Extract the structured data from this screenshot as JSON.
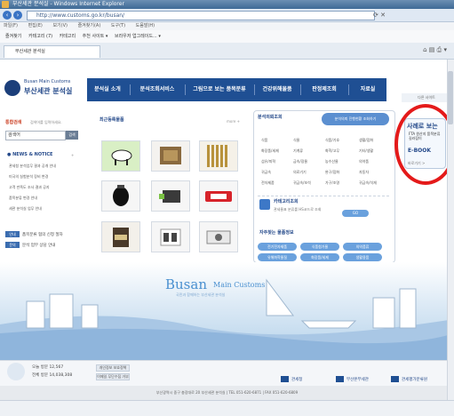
{
  "browser": {
    "window_title": "부산세관 분석실 - Windows Internet Explorer",
    "url": "http://www.customs.go.kr/busan/",
    "menu": [
      "파일(F)",
      "편집(E)",
      "보기(V)",
      "즐겨찾기(A)",
      "도구(T)",
      "도움말(H)"
    ],
    "favorites_bar": [
      "즐겨찾기",
      "카테고리 (7)",
      "카테고리",
      "추천 사이트 ▾",
      "브라우저 업그레이드... ▾"
    ],
    "tab_title": "부산세관 분석실",
    "nav_icons": [
      "back-icon",
      "forward-icon"
    ]
  },
  "site": {
    "logo_en": "Busan Main Customs",
    "logo_ko": "부산세관 분석실",
    "gnb": [
      "분석실 소개",
      "분석조회서비스",
      "그림으로 보는 품목분류",
      "건강위해물품",
      "판정제조회",
      "자료실"
    ],
    "sidetag": "다른 사이트",
    "accent": "#1f4f93"
  },
  "sidebar": {
    "quicksearch_title": "통합검색",
    "quicksearch_desc": "검색어를 입력하세요.",
    "search_placeholder": "검색어",
    "search_button": "검색",
    "news_title": "NEWS & NOTICE",
    "news_more": "+",
    "news_items": [
      "관세청 분석업무 결과 공개 안내",
      "미국의 실험분석 장비 변경",
      "고객 만족도 조사 결과 공지",
      "품목분류 변경 안내",
      "세관 분석실 업무 안내"
    ],
    "bottom_items": [
      {
        "badge": "안내",
        "text": "품목분류 협의 신청 절차"
      },
      {
        "badge": "문의",
        "text": "분석 업무 상담 안내"
      }
    ]
  },
  "recent": {
    "title": "최근등록물품",
    "more": "more +"
  },
  "mid": {
    "title": "분석의뢰조회",
    "tag": "분석의뢰 진행현황 조회하기",
    "grid": [
      [
        "식품",
        "식물",
        "식품/기호",
        "생활/잡화"
      ],
      [
        "화장품/세제",
        "기계류",
        "화학/고무",
        "기타/생활"
      ],
      [
        "섬유/피혁",
        "금속/광물",
        "농수산물",
        "의약품"
      ],
      [
        "귀금속",
        "의료기기",
        "완구/잡화",
        "자동차"
      ],
      [
        "전자제품",
        "귀금속/보석",
        "가구/조명",
        "귀금속/석재"
      ]
    ],
    "hs_title": "카테고리조회",
    "hs_desc": "관세율표 분류를 HS코드로 조회",
    "hs_button": "GO",
    "kw_title": "자주찾는 물품정보",
    "pills": [
      "전기전자제품",
      "식품첨가물",
      "의약품류",
      "유해화학물질",
      "화장품/세제",
      "생활용품"
    ]
  },
  "ebook": {
    "t1": "사례로 보는",
    "t2": "FTA 원산지 품목분류 길라잡이",
    "t3": "E-BOOK",
    "t4": "바로가기 >"
  },
  "visual": {
    "busan": "Busan",
    "main": "Main Customs",
    "sub": "국민과 함께하는 부산세관 분석실"
  },
  "footer": {
    "visit_today_label": "오늘 방문",
    "visit_today": "12,567",
    "visit_total_label": "전체 방문",
    "visit_total": "14,038,308",
    "btn1": "개인정보 보호정책",
    "btn2": "이메일 무단수집 거부",
    "banners": [
      "관세청",
      "부산본부세관",
      "관세평가분류원"
    ],
    "address": "부산광역시 중구 충장대로 20 부산세관 분석실 | TEL 051-620-6871 | FAX 051-620-6809"
  }
}
